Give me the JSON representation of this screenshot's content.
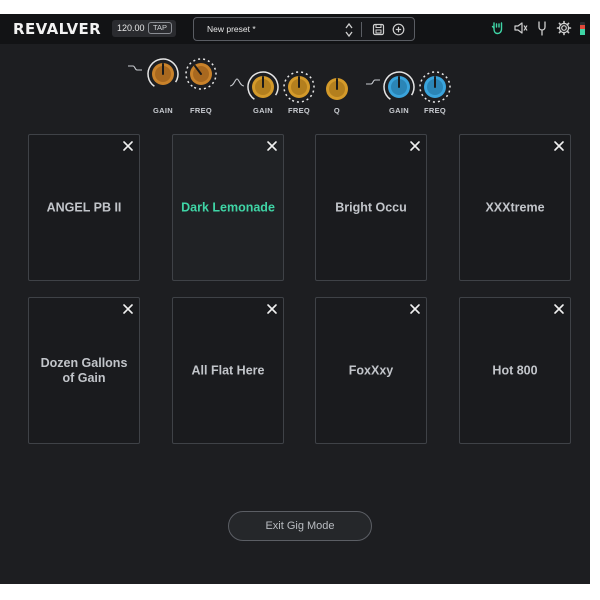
{
  "app": {
    "logo": "REVALVER",
    "tempo_value": "120.00",
    "tap_label": "TAP"
  },
  "preset": {
    "name": "New preset *"
  },
  "toolbar_icons": [
    "hand-rock-icon",
    "speaker-icon",
    "tuner-fork-icon",
    "gear-icon",
    "level-meter-icon"
  ],
  "eq": {
    "bands": [
      {
        "shape": "low-shelf-icon",
        "knobs": [
          {
            "label": "GAIN",
            "color": "#c9822a"
          },
          {
            "label": "FREQ",
            "color": "#c9822a"
          }
        ]
      },
      {
        "shape": "mid-peak-icon",
        "knobs": [
          {
            "label": "GAIN",
            "color": "#d49a2a"
          },
          {
            "label": "FREQ",
            "color": "#d49a2a"
          },
          {
            "label": "Q",
            "color": "#d49a2a"
          }
        ]
      },
      {
        "shape": "high-shelf-icon",
        "knobs": [
          {
            "label": "GAIN",
            "color": "#3aa4dc"
          },
          {
            "label": "FREQ",
            "color": "#3aa4dc"
          }
        ]
      }
    ]
  },
  "gig": {
    "tiles": [
      {
        "name": "ANGEL PB II",
        "active": false
      },
      {
        "name": "Dark Lemonade",
        "active": true
      },
      {
        "name": "Bright Occu",
        "active": false
      },
      {
        "name": "XXXtreme",
        "active": false
      },
      {
        "name": "Dozen Gallons of Gain",
        "active": false
      },
      {
        "name": "All Flat Here",
        "active": false
      },
      {
        "name": "FoxXxy",
        "active": false
      },
      {
        "name": "Hot 800",
        "active": false
      }
    ],
    "exit_label": "Exit Gig Mode"
  },
  "colors": {
    "accent_green": "#3fd5a6",
    "background": "#1d1e21",
    "topbar": "#121315"
  }
}
